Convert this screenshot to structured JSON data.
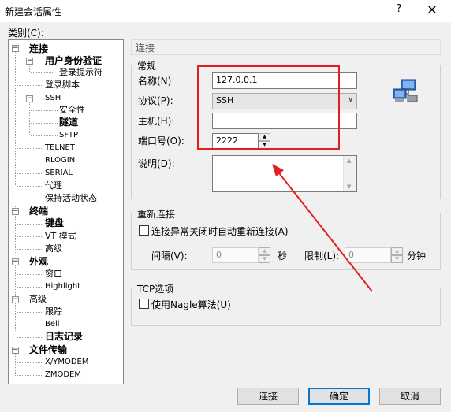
{
  "window": {
    "title": "新建会话属性",
    "help_glyph": "?",
    "close_glyph": "✕"
  },
  "category_label": "类别(C):",
  "tree": {
    "items": [
      {
        "label": "连接"
      },
      {
        "label": "用户身份验证"
      },
      {
        "label": "登录提示符"
      },
      {
        "label": "登录脚本"
      },
      {
        "label": "SSH"
      },
      {
        "label": "安全性"
      },
      {
        "label": "隧道"
      },
      {
        "label": "SFTP"
      },
      {
        "label": "TELNET"
      },
      {
        "label": "RLOGIN"
      },
      {
        "label": "SERIAL"
      },
      {
        "label": "代理"
      },
      {
        "label": "保持活动状态"
      },
      {
        "label": "终端"
      },
      {
        "label": "键盘"
      },
      {
        "label": "VT 模式"
      },
      {
        "label": "高级"
      },
      {
        "label": "外观"
      },
      {
        "label": "窗口"
      },
      {
        "label": "Highlight"
      },
      {
        "label": "高级"
      },
      {
        "label": "跟踪"
      },
      {
        "label": "Bell"
      },
      {
        "label": "日志记录"
      },
      {
        "label": "文件传输"
      },
      {
        "label": "X/YMODEM"
      },
      {
        "label": "ZMODEM"
      }
    ]
  },
  "section_title": "连接",
  "general": {
    "group_title": "常规",
    "name_label": "名称(N):",
    "name_value": "127.0.0.1",
    "protocol_label": "协议(P):",
    "protocol_value": "SSH",
    "host_label": "主机(H):",
    "host_value": "",
    "port_label": "端口号(O):",
    "port_value": "2222",
    "desc_label": "说明(D):"
  },
  "reconnect": {
    "group_title": "重新连接",
    "checkbox_label": "连接异常关闭时自动重新连接(A)",
    "interval_label": "间隔(V):",
    "interval_value": "0",
    "interval_unit": "秒",
    "limit_label": "限制(L):",
    "limit_value": "0",
    "limit_unit": "分钟"
  },
  "tcp": {
    "group_title": "TCP选项",
    "nagle_label": "使用Nagle算法(U)"
  },
  "buttons": {
    "connect": "连接",
    "ok": "确定",
    "cancel": "取消"
  },
  "colors": {
    "annotation": "#e02020",
    "default_button_border": "#0078d7"
  }
}
